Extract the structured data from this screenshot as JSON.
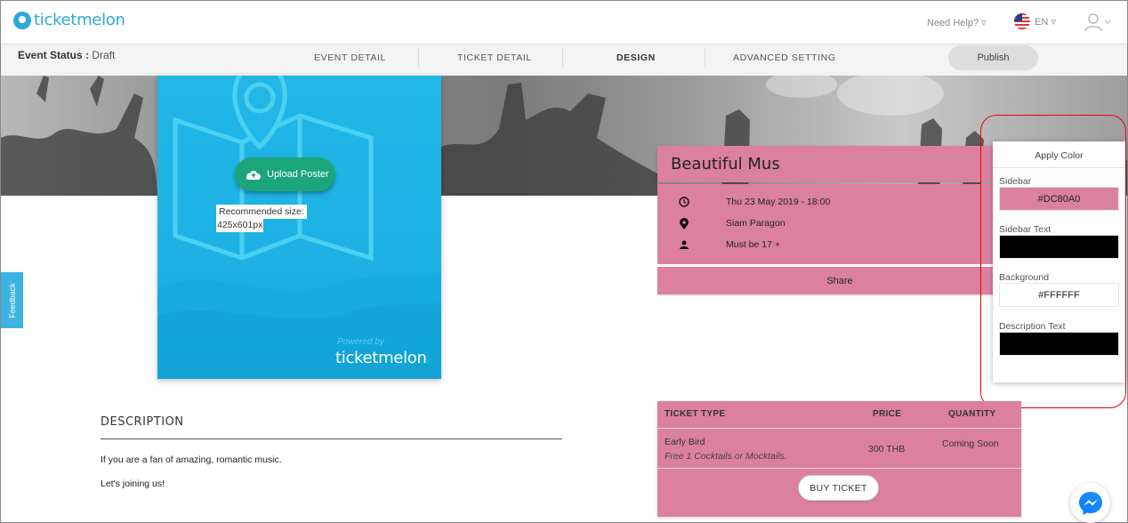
{
  "header": {
    "logo_text": "ticketmelon",
    "help_label": "Need Help? ▿",
    "language": "EN ▿",
    "user_icon": "user-icon"
  },
  "subnav": {
    "status_label": "Event Status :",
    "status_value": "Draft",
    "tabs": [
      {
        "label": "EVENT DETAIL",
        "active": false
      },
      {
        "label": "TICKET DETAIL",
        "active": false
      },
      {
        "label": "DESIGN",
        "active": true
      },
      {
        "label": "ADVANCED SETTING",
        "active": false
      }
    ],
    "publish_label": "Publish"
  },
  "poster": {
    "upload_label": "Upload Poster",
    "recommended_line1": "Recommended size:",
    "recommended_line2": "425x601px",
    "powered_by": "Powered by",
    "logo_text": "ticketmelon"
  },
  "event": {
    "title": "Beautiful Mus",
    "date": "Thu 23 May 2019 - 18:00",
    "venue": "Siam Paragon",
    "age": "Must be 17 +",
    "share_label": "Share"
  },
  "color_panel": {
    "title": "Apply Color",
    "sidebar_label": "Sidebar",
    "sidebar_value": "#DC80A0",
    "sidebar_text_label": "Sidebar Text",
    "sidebar_text_color": "#000000",
    "background_label": "Background",
    "background_value": "#FFFFFF",
    "description_text_label": "Description Text",
    "description_text_color": "#000000"
  },
  "feedback_label": "Feedback",
  "description": {
    "title": "DESCRIPTION",
    "paragraph1": "If you are a fan of amazing, romantic music.",
    "paragraph2": "Let's joining us!"
  },
  "tickets": {
    "headers": {
      "type": "TICKET TYPE",
      "price": "PRICE",
      "quantity": "QUANTITY"
    },
    "rows": [
      {
        "name": "Early Bird",
        "note": "Free 1 Cocktails or Mocktails.",
        "price": "300 THB",
        "quantity": "Coming Soon"
      }
    ],
    "buy_label": "BUY TICKET"
  },
  "colors": {
    "brand": "#2fa8d8",
    "accent": "#DC80A0",
    "upload_green": "#1aa67a",
    "highlight": "#e00000"
  }
}
